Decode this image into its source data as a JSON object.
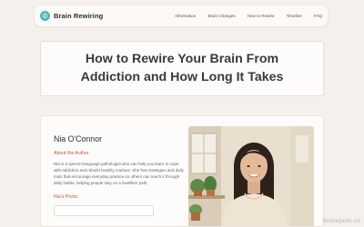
{
  "nav": {
    "brand": "Brain Rewiring",
    "brand_icon": "brain-icon",
    "links": [
      "Information",
      "Brain Changes",
      "How to Rewire",
      "Timeline",
      "FAQ"
    ]
  },
  "article": {
    "title": "How to Rewire Your Brain From Addiction and How Long It Takes"
  },
  "author": {
    "name": "Nia O'Connor",
    "about_heading": "About the Author",
    "bio": "Nia is a speech-language pathologist who can help you learn to cope with addiction and rebuild healthy routines. She has strategies and daily tools that encourage everyday practice so others can reach it through daily habits, helping people stay on a healthier path.",
    "posts_heading": "Nia's Posts:"
  },
  "watermark": "Scorepom.co",
  "colors": {
    "background": "#f4f1ec",
    "accent": "#c05a3c",
    "brand": "#4fb6bb"
  }
}
